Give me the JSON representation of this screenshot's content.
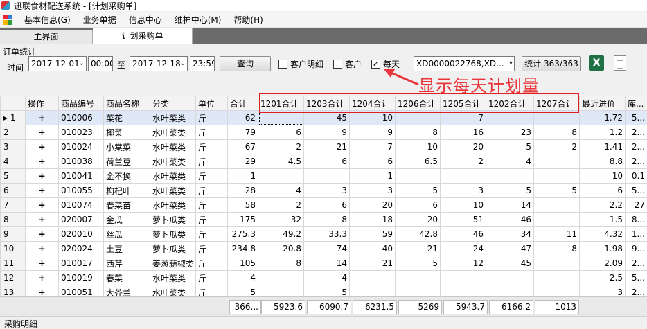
{
  "window": {
    "title": "迅联食材配送系统 - [计划采购单]"
  },
  "menu": {
    "items": [
      "基本信息(G)",
      "业务单据",
      "信息中心",
      "维护中心(M)",
      "帮助(H)"
    ]
  },
  "tabs": [
    {
      "label": "主界面"
    },
    {
      "label": "计划采购单"
    }
  ],
  "filter": {
    "group_title": "订单统计",
    "time_label": "时间",
    "date_from": "2017-12-01",
    "time_from": "00:00",
    "to_label": "至",
    "date_to": "2017-12-18",
    "time_to": "23:59",
    "query_button": "查询",
    "chk_customer_detail": "客户明细",
    "chk_customer": "客户",
    "chk_daily": "每天",
    "daily_checked": "✓",
    "order_select": "XD0000022768,XD...",
    "stats_button": "统计 363/363"
  },
  "annotation": "显示每天计划量",
  "table": {
    "columns": [
      "操作",
      "商品编号",
      "商品名称",
      "分类",
      "单位",
      "合计",
      "1201合计",
      "1203合计",
      "1204合计",
      "1206合计",
      "1205合计",
      "1202合计",
      "1207合计",
      "最近进价",
      "库..."
    ],
    "rows": [
      [
        "▸ 1",
        "+",
        "010006",
        "菜花",
        "水叶菜类",
        "斤",
        "62",
        "",
        "45",
        "10",
        "",
        "7",
        "",
        "",
        "1.72",
        "5..."
      ],
      [
        "2",
        "+",
        "010023",
        "椰菜",
        "水叶菜类",
        "斤",
        "79",
        "6",
        "9",
        "9",
        "8",
        "16",
        "23",
        "8",
        "1.2",
        "2..."
      ],
      [
        "3",
        "+",
        "010024",
        "小棠菜",
        "水叶菜类",
        "斤",
        "67",
        "2",
        "21",
        "7",
        "10",
        "20",
        "5",
        "2",
        "1.41",
        "2..."
      ],
      [
        "4",
        "+",
        "010038",
        "荷兰豆",
        "水叶菜类",
        "斤",
        "29",
        "4.5",
        "6",
        "6",
        "6.5",
        "2",
        "4",
        "",
        "8.8",
        "2..."
      ],
      [
        "5",
        "+",
        "010041",
        "金不换",
        "水叶菜类",
        "斤",
        "1",
        "",
        "",
        "1",
        "",
        "",
        "",
        "",
        "10",
        "0.1"
      ],
      [
        "6",
        "+",
        "010055",
        "枸杞叶",
        "水叶菜类",
        "斤",
        "28",
        "4",
        "3",
        "3",
        "5",
        "3",
        "5",
        "5",
        "6",
        "5..."
      ],
      [
        "7",
        "+",
        "010074",
        "春菜苗",
        "水叶菜类",
        "斤",
        "58",
        "2",
        "6",
        "20",
        "6",
        "10",
        "14",
        "",
        "2.2",
        "27"
      ],
      [
        "8",
        "+",
        "020007",
        "金瓜",
        "萝卜瓜类",
        "斤",
        "175",
        "32",
        "8",
        "18",
        "20",
        "51",
        "46",
        "",
        "1.5",
        "8..."
      ],
      [
        "9",
        "+",
        "020010",
        "丝瓜",
        "萝卜瓜类",
        "斤",
        "275.3",
        "49.2",
        "33.3",
        "59",
        "42.8",
        "46",
        "34",
        "11",
        "4.32",
        "1..."
      ],
      [
        "10",
        "+",
        "020024",
        "土豆",
        "萝卜瓜类",
        "斤",
        "234.8",
        "20.8",
        "74",
        "40",
        "21",
        "24",
        "47",
        "8",
        "1.98",
        "9..."
      ],
      [
        "11",
        "+",
        "010017",
        "西芹",
        "姜葱蒜椒类",
        "斤",
        "105",
        "8",
        "14",
        "21",
        "5",
        "12",
        "45",
        "",
        "2.09",
        "2..."
      ],
      [
        "12",
        "+",
        "010019",
        "春菜",
        "水叶菜类",
        "斤",
        "4",
        "",
        "4",
        "",
        "",
        "",
        "",
        "",
        "2.5",
        "5..."
      ],
      [
        "13",
        "+",
        "010051",
        "大芥兰",
        "水叶菜类",
        "斤",
        "5",
        "",
        "5",
        "",
        "",
        "",
        "",
        "",
        "3",
        "2..."
      ]
    ]
  },
  "totals": [
    "366...",
    "5923.6",
    "6090.7",
    "6231.5",
    "5269",
    "5943.7",
    "6166.2",
    "1013"
  ],
  "bottom_label": "采购明细"
}
